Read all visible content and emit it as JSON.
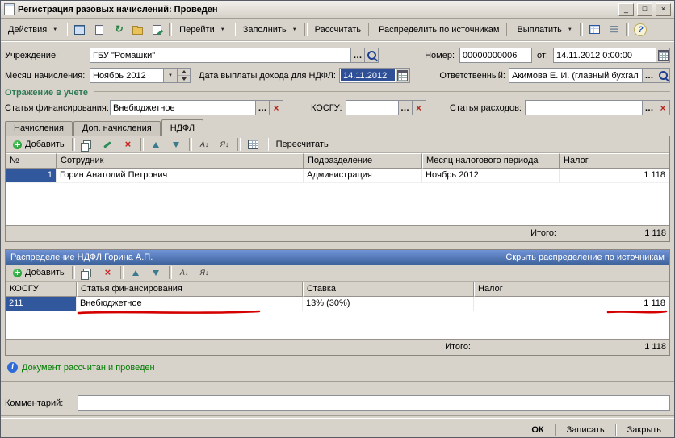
{
  "window": {
    "title": "Регистрация разовых начислений: Проведен",
    "minimize": "_",
    "maximize": "□",
    "close": "×"
  },
  "toolbar": {
    "actions": "Действия",
    "goto": "Перейти",
    "fill": "Заполнить",
    "calculate": "Рассчитать",
    "distribute": "Распределить по источникам",
    "pay": "Выплатить"
  },
  "form": {
    "institution_label": "Учреждение:",
    "institution_value": "ГБУ \"Ромашки\"",
    "number_label": "Номер:",
    "number_value": "00000000006",
    "date_label": "от:",
    "date_value": "14.11.2012 0:00:00",
    "month_label": "Месяц начисления:",
    "month_value": "Ноябрь 2012",
    "ndfl_date_label": "Дата выплаты дохода для НДФЛ:",
    "ndfl_date_value": "14.11.2012",
    "responsible_label": "Ответственный:",
    "responsible_value": "Акимова Е. И. (главный бухгалтер",
    "section_title": "Отражение в учете",
    "financing_label": "Статья финансирования:",
    "financing_value": "Внебюджетное",
    "kosgu_label": "КОСГУ:",
    "kosgu_value": "",
    "expense_label": "Статья расходов:",
    "expense_value": ""
  },
  "tabs": [
    {
      "label": "Начисления"
    },
    {
      "label": "Доп. начисления"
    },
    {
      "label": "НДФЛ"
    }
  ],
  "main_table": {
    "add": "Добавить",
    "recalculate": "Пересчитать",
    "columns": [
      "№",
      "Сотрудник",
      "Подразделение",
      "Месяц налогового периода",
      "Налог"
    ],
    "rows": [
      {
        "num": "1",
        "employee": "Горин Анатолий Петрович",
        "department": "Администрация",
        "period": "Ноябрь 2012",
        "tax": "1 118"
      }
    ],
    "total_label": "Итого:",
    "total_value": "1 118"
  },
  "distribution": {
    "title": "Распределение НДФЛ Горина А.П.",
    "hide_link": "Скрыть распределение по источникам",
    "add": "Добавить",
    "columns": [
      "КОСГУ",
      "Статья финансирования",
      "Ставка",
      "Налог"
    ],
    "rows": [
      {
        "kosgu": "211",
        "financing": "Внебюджетное",
        "rate": "13% (30%)",
        "tax": "1 118"
      }
    ],
    "total_label": "Итого:",
    "total_value": "1 118"
  },
  "status": {
    "message": "Документ рассчитан и проведен"
  },
  "comment_label": "Комментарий:",
  "comment_value": "",
  "footer": {
    "ok": "ОК",
    "save": "Записать",
    "close": "Закрыть"
  },
  "colors": {
    "selection_blue": "#31589c",
    "distribution_header_blue": "#3d639c",
    "status_green": "#007d00",
    "annotation_red": "#d40000",
    "section_green": "#2c7a52"
  }
}
